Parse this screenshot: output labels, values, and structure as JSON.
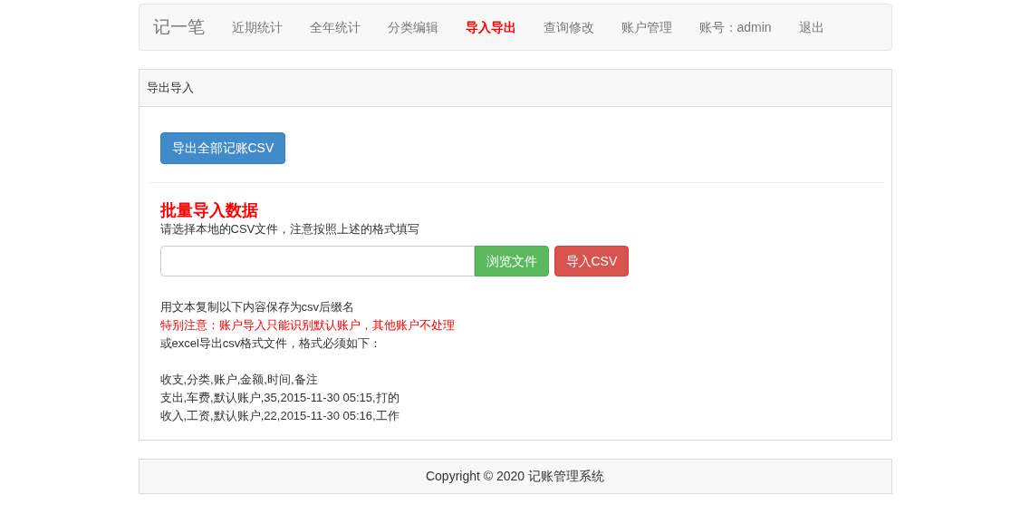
{
  "navbar": {
    "brand": "记一笔",
    "items": [
      {
        "label": "近期统计",
        "selected": false
      },
      {
        "label": "全年统计",
        "selected": false
      },
      {
        "label": "分类编辑",
        "selected": false
      },
      {
        "label": "导入导出",
        "selected": true
      },
      {
        "label": "查询修改",
        "selected": false
      },
      {
        "label": "账户管理",
        "selected": false
      },
      {
        "label": "账号：admin",
        "selected": false
      },
      {
        "label": "退出",
        "selected": false
      }
    ]
  },
  "panel": {
    "title": "导出导入",
    "export_button": "导出全部记账CSV",
    "import_heading": "批量导入数据",
    "import_hint": "请选择本地的CSV文件，注意按照上述的格式填写",
    "browse_button": "浏览文件",
    "import_button": "导入CSV",
    "notes": [
      {
        "text": "用文本复制以下内容保存为csv后缀名",
        "kind": "normal"
      },
      {
        "text": "特别注意：账户导入只能识别默认账户，其他账户不处理",
        "kind": "warning"
      },
      {
        "text": "或excel导出csv格式文件，格式必须如下：",
        "kind": "normal"
      }
    ],
    "sample_lines": [
      "收支,分类,账户,金额,时间,备注",
      "支出,车费,默认账户,35,2015-11-30 05:15,打的",
      "收入,工资,默认账户,22,2015-11-30 05:16,工作"
    ]
  },
  "footer": "Copyright © 2020 记账管理系统"
}
